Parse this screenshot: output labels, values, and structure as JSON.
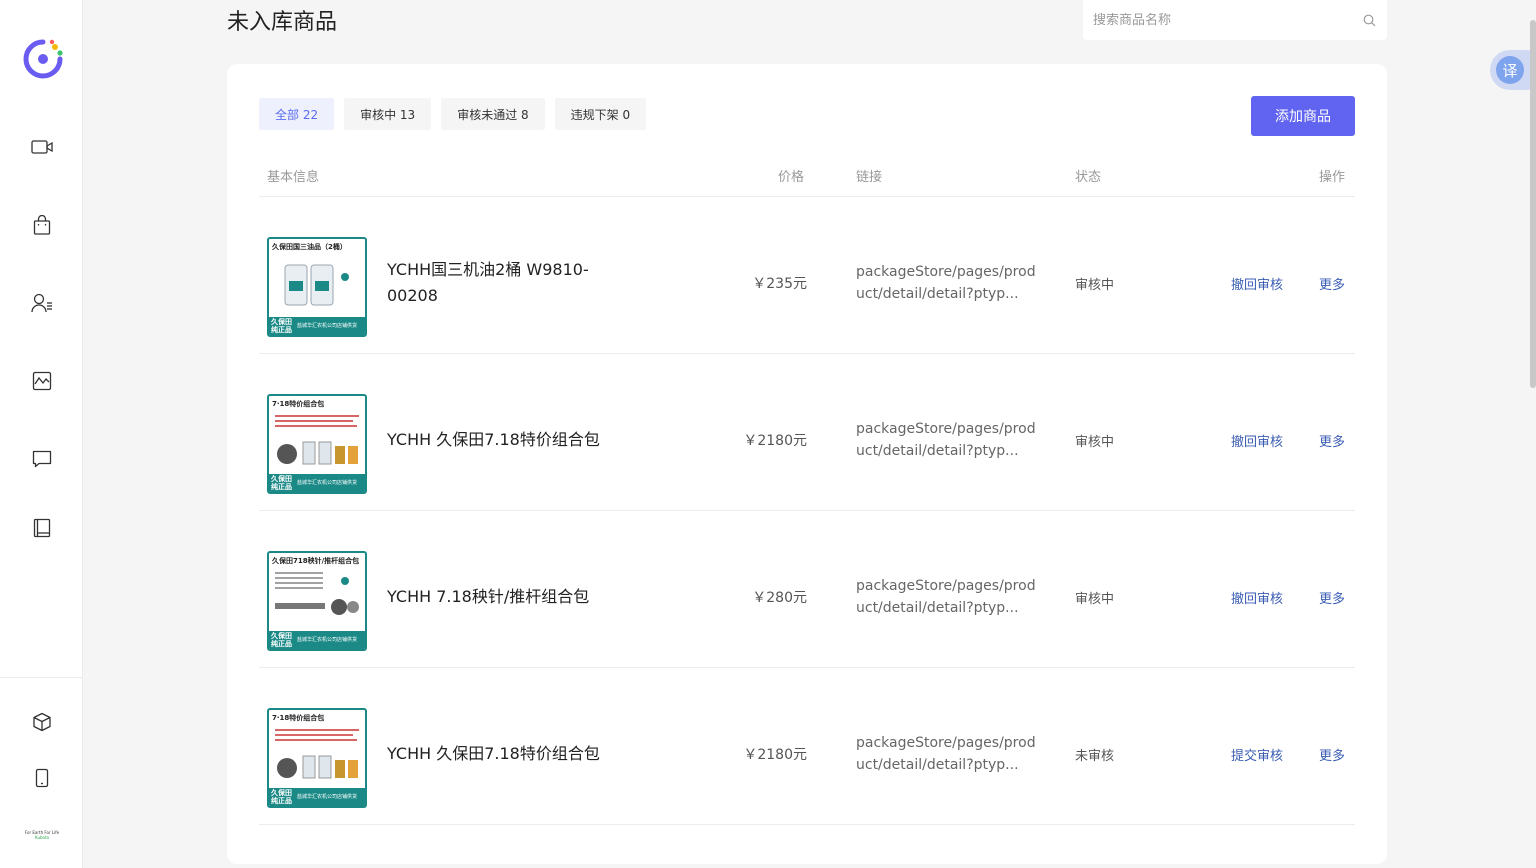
{
  "page": {
    "title": "未入库商品"
  },
  "search": {
    "placeholder": "搜索商品名称"
  },
  "translate": {
    "label": "译"
  },
  "tabs": [
    {
      "label": "全部 22",
      "active": true
    },
    {
      "label": "审核中 13",
      "active": false
    },
    {
      "label": "审核未通过 8",
      "active": false
    },
    {
      "label": "违规下架 0",
      "active": false
    }
  ],
  "add_button": {
    "label": "添加商品"
  },
  "table": {
    "headers": {
      "basic": "基本信息",
      "price": "价格",
      "link": "链接",
      "status": "状态",
      "action": "操作"
    },
    "rows": [
      {
        "thumb_title": "久保田国三油品（2桶）",
        "name": "YCHH国三机油2桶 W9810-00208",
        "price": "￥235元",
        "link": "packageStore/pages/product/detail/detail?ptyp...",
        "status": "审核中",
        "action1": "撤回审核",
        "action2": "更多"
      },
      {
        "thumb_title": "7·18特价组合包",
        "name": "YCHH 久保田7.18特价组合包",
        "price": "￥2180元",
        "link": "packageStore/pages/product/detail/detail?ptyp...",
        "status": "审核中",
        "action1": "撤回审核",
        "action2": "更多"
      },
      {
        "thumb_title": "久保田718秧针/推杆组合包",
        "name": "YCHH 7.18秧针/推杆组合包",
        "price": "￥280元",
        "link": "packageStore/pages/product/detail/detail?ptyp...",
        "status": "审核中",
        "action1": "撤回审核",
        "action2": "更多"
      },
      {
        "thumb_title": "7·18特价组合包",
        "name": "YCHH 久保田7.18特价组合包",
        "price": "￥2180元",
        "link": "packageStore/pages/product/detail/detail?ptyp...",
        "status": "未审核",
        "action1": "提交审核",
        "action2": "更多"
      }
    ]
  },
  "thumb_badge": {
    "left": "久保田纯正品",
    "right": "盐城华汇农机公司店铺供货"
  },
  "sidebar": {
    "footer_text": "For Earth For Life",
    "footer_sub": "Kubota"
  },
  "colors": {
    "accent": "#6064f0",
    "thumb_border": "#1b8a87",
    "action": "#3a5db3"
  }
}
